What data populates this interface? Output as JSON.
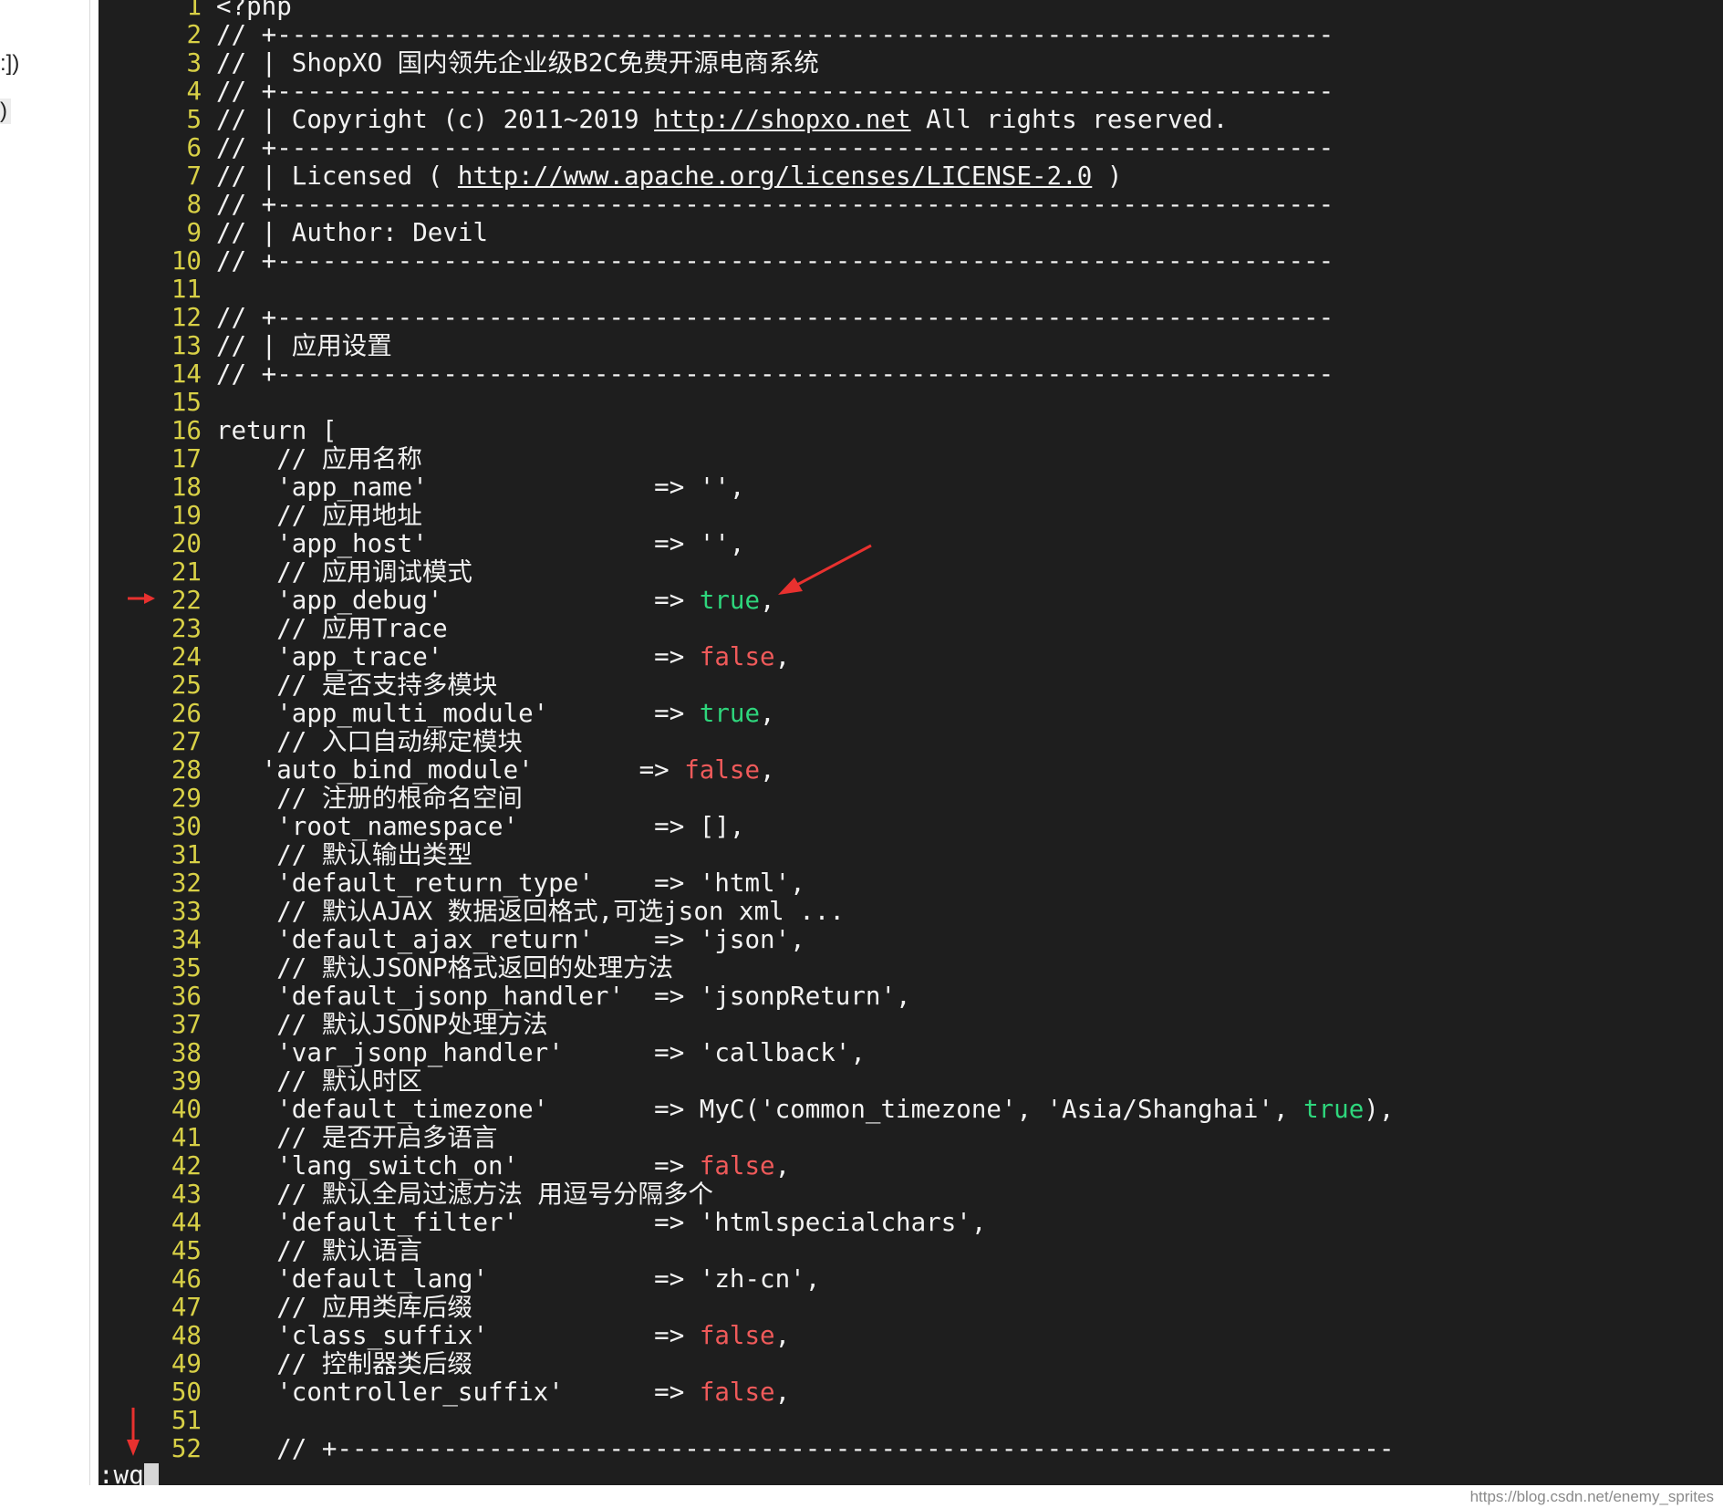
{
  "left_panel": {
    "fragment_1": ":])",
    "fragment_2": ")"
  },
  "code_lines": [
    {
      "n": "1",
      "segs": [
        {
          "t": "<?php"
        }
      ]
    },
    {
      "n": "2",
      "segs": [
        {
          "t": "// +----------------------------------------------------------------------"
        }
      ]
    },
    {
      "n": "3",
      "segs": [
        {
          "t": "// | ShopXO 国内领先企业级B2C免费开源电商系统"
        }
      ]
    },
    {
      "n": "4",
      "segs": [
        {
          "t": "// +----------------------------------------------------------------------"
        }
      ]
    },
    {
      "n": "5",
      "segs": [
        {
          "t": "// | Copyright (c) 2011~2019 "
        },
        {
          "t": "http://shopxo.net",
          "c": "url"
        },
        {
          "t": " All rights reserved."
        }
      ]
    },
    {
      "n": "6",
      "segs": [
        {
          "t": "// +----------------------------------------------------------------------"
        }
      ]
    },
    {
      "n": "7",
      "segs": [
        {
          "t": "// | Licensed ( "
        },
        {
          "t": "http://www.apache.org/licenses/LICENSE-2.0",
          "c": "url"
        },
        {
          "t": " )"
        }
      ]
    },
    {
      "n": "8",
      "segs": [
        {
          "t": "// +----------------------------------------------------------------------"
        }
      ]
    },
    {
      "n": "9",
      "segs": [
        {
          "t": "// | Author: Devil"
        }
      ]
    },
    {
      "n": "10",
      "segs": [
        {
          "t": "// +----------------------------------------------------------------------"
        }
      ]
    },
    {
      "n": "11",
      "segs": []
    },
    {
      "n": "12",
      "segs": [
        {
          "t": "// +----------------------------------------------------------------------"
        }
      ]
    },
    {
      "n": "13",
      "segs": [
        {
          "t": "// | 应用设置"
        }
      ]
    },
    {
      "n": "14",
      "segs": [
        {
          "t": "// +----------------------------------------------------------------------"
        }
      ]
    },
    {
      "n": "15",
      "segs": []
    },
    {
      "n": "16",
      "segs": [
        {
          "t": "return ["
        }
      ]
    },
    {
      "n": "17",
      "segs": [
        {
          "t": "    // 应用名称"
        }
      ]
    },
    {
      "n": "18",
      "segs": [
        {
          "t": "    'app_name'               => '',"
        }
      ]
    },
    {
      "n": "19",
      "segs": [
        {
          "t": "    // 应用地址"
        }
      ]
    },
    {
      "n": "20",
      "segs": [
        {
          "t": "    'app_host'               => '',"
        }
      ]
    },
    {
      "n": "21",
      "segs": [
        {
          "t": "    // 应用调试模式"
        }
      ]
    },
    {
      "n": "22",
      "segs": [
        {
          "t": "    'app_debug'              => "
        },
        {
          "t": "true",
          "c": "t-true"
        },
        {
          "t": ","
        }
      ]
    },
    {
      "n": "23",
      "segs": [
        {
          "t": "    // 应用Trace"
        }
      ]
    },
    {
      "n": "24",
      "segs": [
        {
          "t": "    'app_trace'              => "
        },
        {
          "t": "false",
          "c": "t-false"
        },
        {
          "t": ","
        }
      ]
    },
    {
      "n": "25",
      "segs": [
        {
          "t": "    // 是否支持多模块"
        }
      ]
    },
    {
      "n": "26",
      "segs": [
        {
          "t": "    'app_multi_module'       => "
        },
        {
          "t": "true",
          "c": "t-true"
        },
        {
          "t": ","
        }
      ]
    },
    {
      "n": "27",
      "segs": [
        {
          "t": "    // 入口自动绑定模块"
        }
      ]
    },
    {
      "n": "28",
      "segs": [
        {
          "t": "   'auto_bind_module'       => "
        },
        {
          "t": "false",
          "c": "t-false"
        },
        {
          "t": ","
        }
      ]
    },
    {
      "n": "29",
      "segs": [
        {
          "t": "    // 注册的根命名空间"
        }
      ]
    },
    {
      "n": "30",
      "segs": [
        {
          "t": "    'root_namespace'         => [],"
        }
      ]
    },
    {
      "n": "31",
      "segs": [
        {
          "t": "    // 默认输出类型"
        }
      ]
    },
    {
      "n": "32",
      "segs": [
        {
          "t": "    'default_return_type'    => 'html',"
        }
      ]
    },
    {
      "n": "33",
      "segs": [
        {
          "t": "    // 默认AJAX 数据返回格式,可选json xml ..."
        }
      ]
    },
    {
      "n": "34",
      "segs": [
        {
          "t": "    'default_ajax_return'    => 'json',"
        }
      ]
    },
    {
      "n": "35",
      "segs": [
        {
          "t": "    // 默认JSONP格式返回的处理方法"
        }
      ]
    },
    {
      "n": "36",
      "segs": [
        {
          "t": "    'default_jsonp_handler'  => 'jsonpReturn',"
        }
      ]
    },
    {
      "n": "37",
      "segs": [
        {
          "t": "    // 默认JSONP处理方法"
        }
      ]
    },
    {
      "n": "38",
      "segs": [
        {
          "t": "    'var_jsonp_handler'      => 'callback',"
        }
      ]
    },
    {
      "n": "39",
      "segs": [
        {
          "t": "    // 默认时区"
        }
      ]
    },
    {
      "n": "40",
      "segs": [
        {
          "t": "    'default_timezone'       => MyC('common_timezone', 'Asia/Shanghai', "
        },
        {
          "t": "true",
          "c": "t-true"
        },
        {
          "t": "),"
        }
      ]
    },
    {
      "n": "41",
      "segs": [
        {
          "t": "    // 是否开启多语言"
        }
      ]
    },
    {
      "n": "42",
      "segs": [
        {
          "t": "    'lang_switch_on'         => "
        },
        {
          "t": "false",
          "c": "t-false"
        },
        {
          "t": ","
        }
      ]
    },
    {
      "n": "43",
      "segs": [
        {
          "t": "    // 默认全局过滤方法 用逗号分隔多个"
        }
      ]
    },
    {
      "n": "44",
      "segs": [
        {
          "t": "    'default_filter'         => 'htmlspecialchars',"
        }
      ]
    },
    {
      "n": "45",
      "segs": [
        {
          "t": "    // 默认语言"
        }
      ]
    },
    {
      "n": "46",
      "segs": [
        {
          "t": "    'default_lang'           => 'zh-cn',"
        }
      ]
    },
    {
      "n": "47",
      "segs": [
        {
          "t": "    // 应用类库后缀"
        }
      ]
    },
    {
      "n": "48",
      "segs": [
        {
          "t": "    'class_suffix'           => "
        },
        {
          "t": "false",
          "c": "t-false"
        },
        {
          "t": ","
        }
      ]
    },
    {
      "n": "49",
      "segs": [
        {
          "t": "    // 控制器类后缀"
        }
      ]
    },
    {
      "n": "50",
      "segs": [
        {
          "t": "    'controller_suffix'      => "
        },
        {
          "t": "false",
          "c": "t-false"
        },
        {
          "t": ","
        }
      ]
    },
    {
      "n": "51",
      "segs": []
    },
    {
      "n": "52",
      "segs": [
        {
          "t": "    // +----------------------------------------------------------------------"
        }
      ]
    }
  ],
  "command_line": ":wq",
  "watermark": "https://blog.csdn.net/enemy_sprites",
  "colors": {
    "background": "#1e1e1e",
    "line_number": "#d8d046",
    "text": "#f2f2f2",
    "keyword_true": "#2ed67c",
    "keyword_false": "#ef5a5a",
    "annotation_arrow": "#e8312f"
  }
}
